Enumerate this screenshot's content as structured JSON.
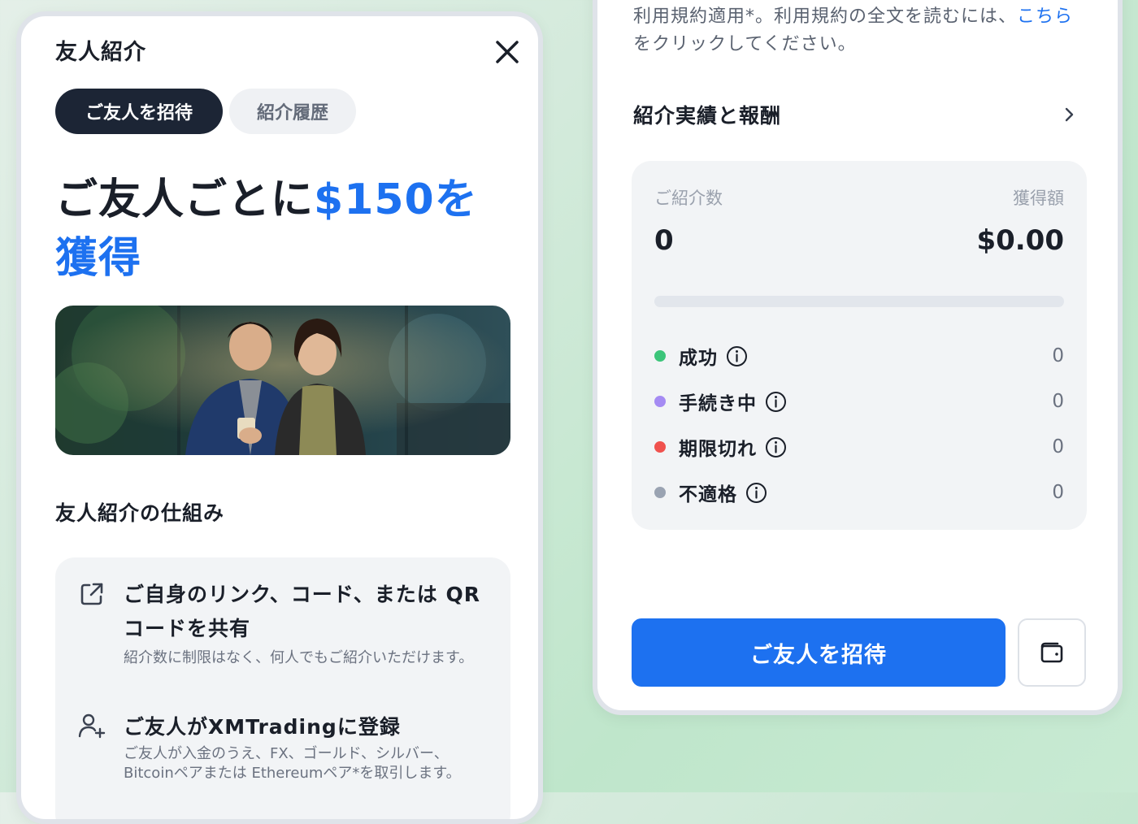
{
  "modal": {
    "title": "友人紹介",
    "tabs": [
      {
        "label": "ご友人を招待",
        "active": true
      },
      {
        "label": "紹介履歴",
        "active": false
      }
    ],
    "headline_prefix": "ご友人ごとに",
    "headline_accent": "$150を獲得",
    "how_it_works_title": "友人紹介の仕組み",
    "steps": [
      {
        "icon": "share-external-icon",
        "title": "ご自身のリンク、コード、または QRコードを共有",
        "description": "紹介数に制限はなく、何人でもご紹介いただけます。"
      },
      {
        "icon": "add-user-icon",
        "title": "ご友人がXMTradingに登録",
        "description": "ご友人が入金のうえ、FX、ゴールド、シルバー、Bitcoinペアまたは Ethereumペア*を取引します。"
      }
    ]
  },
  "rewards": {
    "terms_text": "利用規約適用*。利用規約の全文を読むには、",
    "terms_link": "こちら",
    "terms_suffix": "をクリックしてください。",
    "performance_title": "紹介実績と報酬",
    "referrals_label": "ご紹介数",
    "earned_label": "獲得額",
    "referrals_value": "0",
    "earned_value": "$0.00",
    "progress_fraction": 0,
    "statuses": [
      {
        "label": "成功",
        "count": "0",
        "color": "#3cc57a"
      },
      {
        "label": "手続き中",
        "count": "0",
        "color": "#a58bf3"
      },
      {
        "label": "期限切れ",
        "count": "0",
        "color": "#f0524e"
      },
      {
        "label": "不適格",
        "count": "0",
        "color": "#9aa3b2"
      }
    ],
    "invite_button": "ご友人を招待",
    "wallet_icon": "wallet-icon"
  },
  "colors": {
    "accent": "#1d71f0",
    "dark_tab": "#1c2535"
  }
}
